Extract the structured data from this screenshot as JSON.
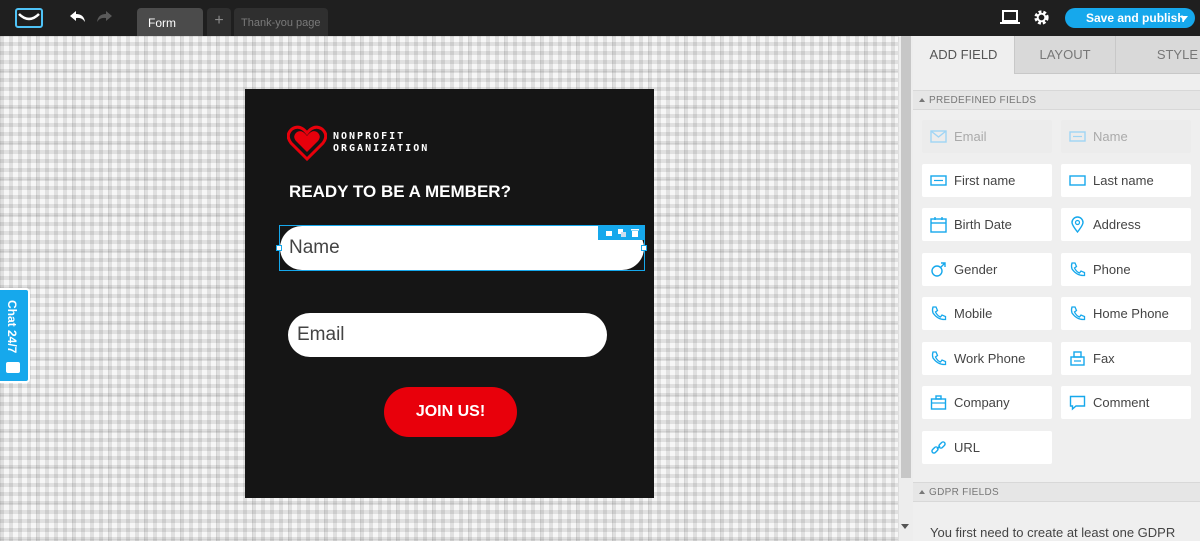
{
  "topbar": {
    "tabs": {
      "form": "Form",
      "add": "+",
      "thankyou": "Thank-you page"
    },
    "save_label": "Save and publish",
    "accent": "#16a8ec"
  },
  "canvas": {
    "chat_label": "Chat 24/7",
    "form": {
      "org_name": "NONPROFIT ORGANIZATION",
      "headline": "READY TO BE A MEMBER?",
      "name_placeholder": "Name",
      "email_placeholder": "Email",
      "join_label": "JOIN US!",
      "card_bg": "#151515",
      "button_color": "#e8000b"
    }
  },
  "panel": {
    "tabs": [
      "ADD FIELD",
      "LAYOUT",
      "STYLE"
    ],
    "predefined_header": "PREDEFINED FIELDS",
    "fields": [
      {
        "label": "Email",
        "icon": "envelope-icon",
        "disabled": true
      },
      {
        "label": "Name",
        "icon": "text-lines-icon",
        "disabled": true
      },
      {
        "label": "First name",
        "icon": "text-field-icon",
        "disabled": false
      },
      {
        "label": "Last name",
        "icon": "text-field-icon",
        "disabled": false
      },
      {
        "label": "Birth Date",
        "icon": "calendar-icon",
        "disabled": false
      },
      {
        "label": "Address",
        "icon": "map-pin-icon",
        "disabled": false
      },
      {
        "label": "Gender",
        "icon": "gender-icon",
        "disabled": false
      },
      {
        "label": "Phone",
        "icon": "phone-icon",
        "disabled": false
      },
      {
        "label": "Mobile",
        "icon": "phone-icon",
        "disabled": false
      },
      {
        "label": "Home Phone",
        "icon": "phone-icon",
        "disabled": false
      },
      {
        "label": "Work Phone",
        "icon": "phone-icon",
        "disabled": false
      },
      {
        "label": "Fax",
        "icon": "fax-icon",
        "disabled": false
      },
      {
        "label": "Company",
        "icon": "briefcase-icon",
        "disabled": false
      },
      {
        "label": "Comment",
        "icon": "comment-icon",
        "disabled": false
      },
      {
        "label": "URL",
        "icon": "link-icon",
        "disabled": false
      }
    ],
    "gdpr_header": "GDPR FIELDS",
    "gdpr_text": "You first need to create at least one GDPR field."
  }
}
